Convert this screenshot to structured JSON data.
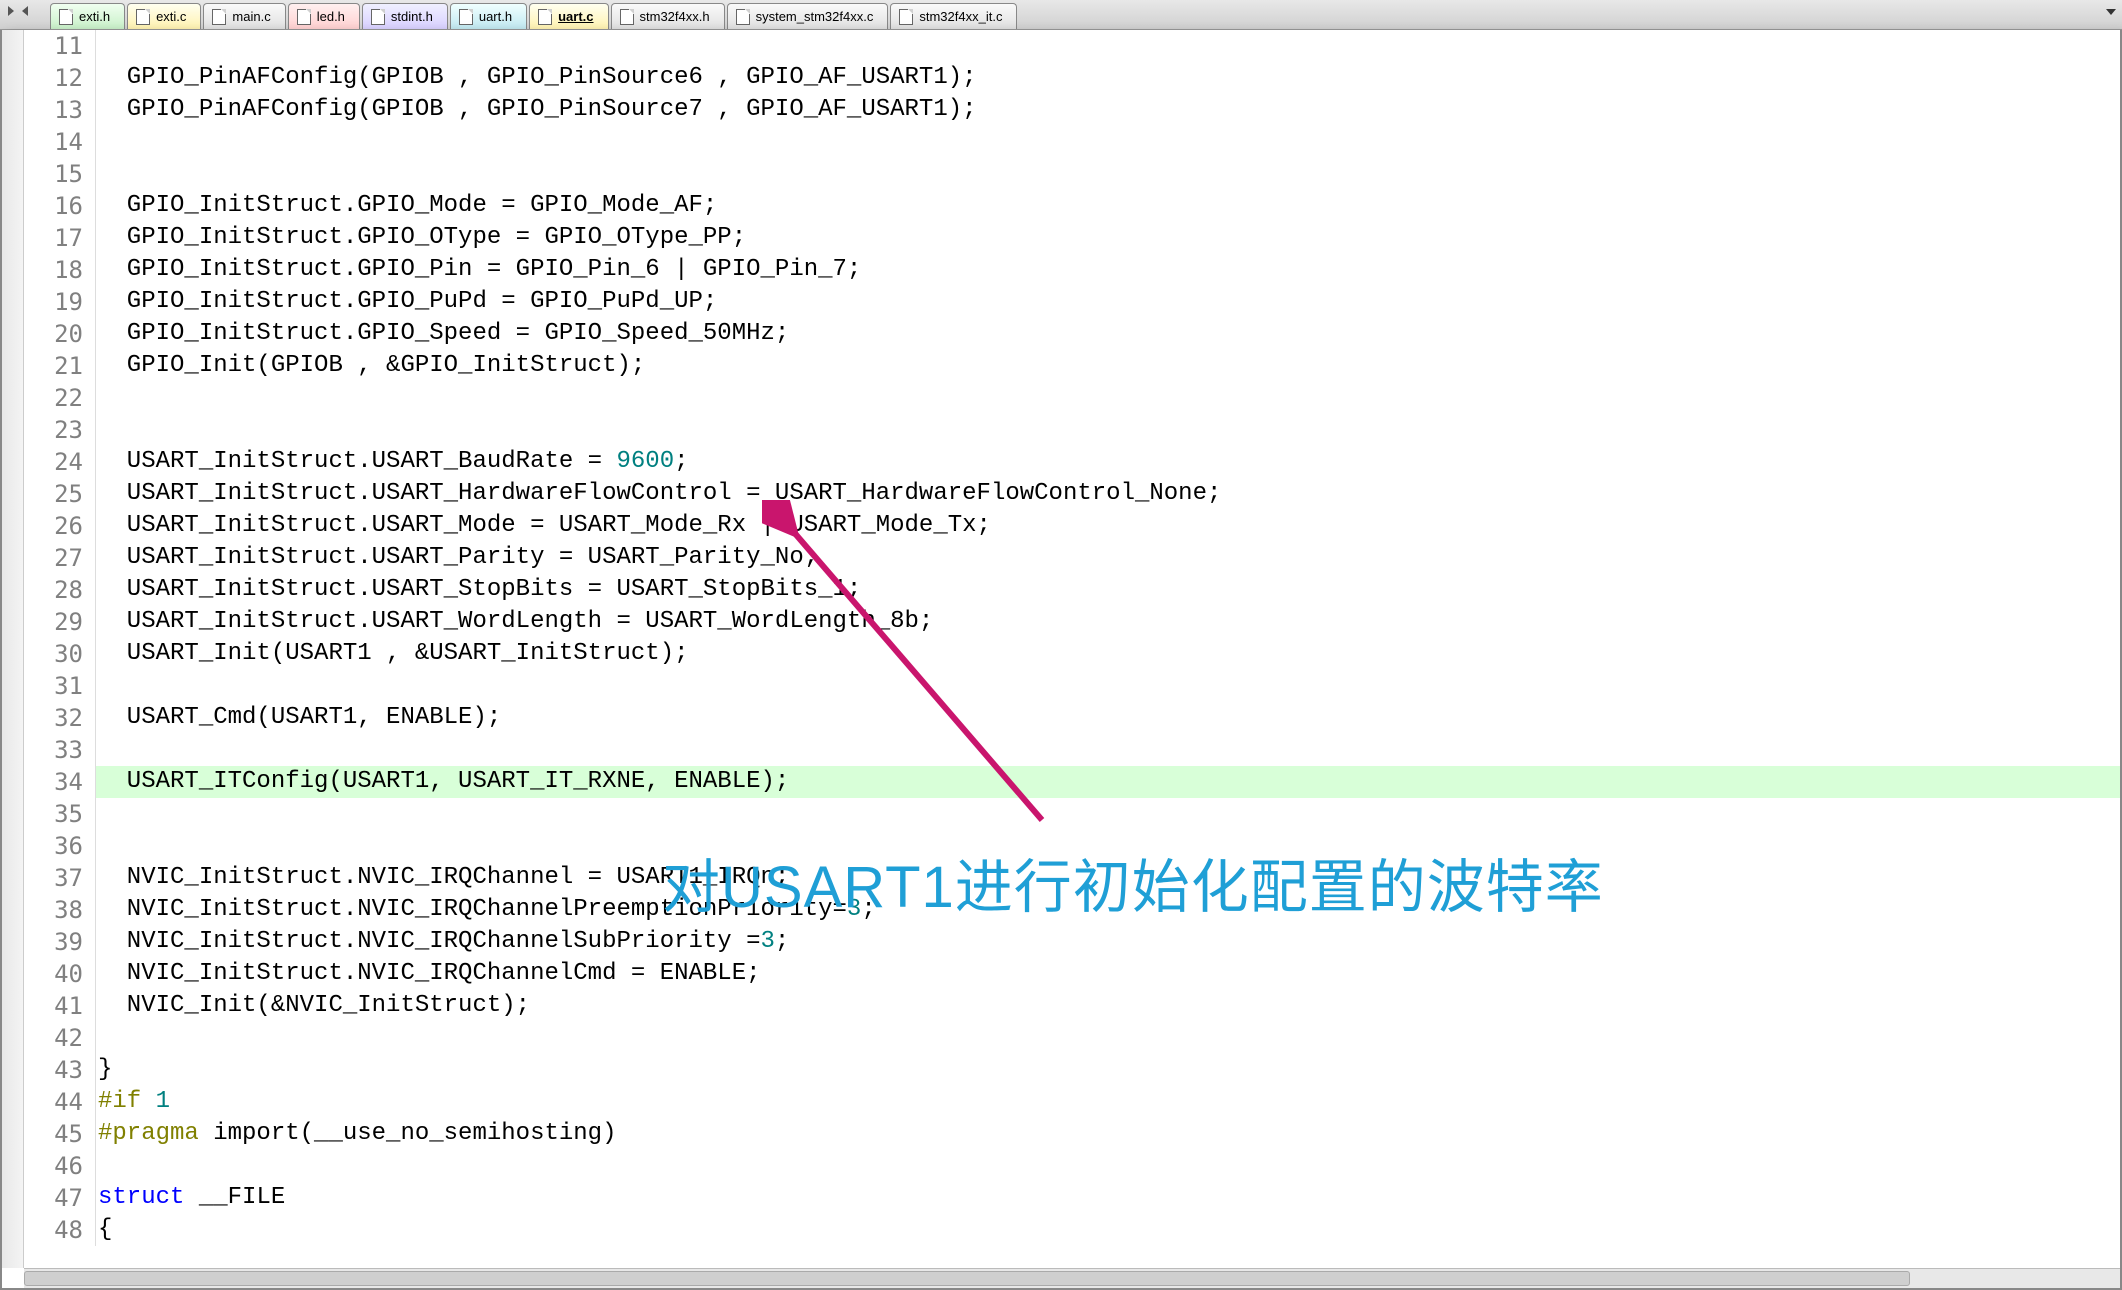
{
  "tabs": [
    {
      "label": "exti.h",
      "style": "green"
    },
    {
      "label": "exti.c",
      "style": "yellow"
    },
    {
      "label": "main.c",
      "style": "plain"
    },
    {
      "label": "led.h",
      "style": "pink"
    },
    {
      "label": "stdint.h",
      "style": "lav"
    },
    {
      "label": "uart.h",
      "style": "blue"
    },
    {
      "label": "uart.c",
      "style": "active",
      "active": true
    },
    {
      "label": "stm32f4xx.h",
      "style": "plain"
    },
    {
      "label": "system_stm32f4xx.c",
      "style": "plain"
    },
    {
      "label": "stm32f4xx_it.c",
      "style": "plain"
    }
  ],
  "annotation_text": "对USART1进行初始化配置的波特率",
  "code": [
    {
      "n": 11,
      "t": ""
    },
    {
      "n": 12,
      "t": "  GPIO_PinAFConfig(GPIOB , GPIO_PinSource6 , GPIO_AF_USART1);"
    },
    {
      "n": 13,
      "t": "  GPIO_PinAFConfig(GPIOB , GPIO_PinSource7 , GPIO_AF_USART1);"
    },
    {
      "n": 14,
      "t": ""
    },
    {
      "n": 15,
      "t": ""
    },
    {
      "n": 16,
      "t": "  GPIO_InitStruct.GPIO_Mode = GPIO_Mode_AF;"
    },
    {
      "n": 17,
      "t": "  GPIO_InitStruct.GPIO_OType = GPIO_OType_PP;"
    },
    {
      "n": 18,
      "t": "  GPIO_InitStruct.GPIO_Pin = GPIO_Pin_6 | GPIO_Pin_7;"
    },
    {
      "n": 19,
      "t": "  GPIO_InitStruct.GPIO_PuPd = GPIO_PuPd_UP;"
    },
    {
      "n": 20,
      "t": "  GPIO_InitStruct.GPIO_Speed = GPIO_Speed_50MHz;"
    },
    {
      "n": 21,
      "t": "  GPIO_Init(GPIOB , &GPIO_InitStruct);"
    },
    {
      "n": 22,
      "t": ""
    },
    {
      "n": 23,
      "t": ""
    },
    {
      "n": 24,
      "t": "  USART_InitStruct.USART_BaudRate = ",
      "num": "9600",
      "after": ";"
    },
    {
      "n": 25,
      "t": "  USART_InitStruct.USART_HardwareFlowControl = USART_HardwareFlowControl_None;"
    },
    {
      "n": 26,
      "t": "  USART_InitStruct.USART_Mode = USART_Mode_Rx | USART_Mode_Tx;"
    },
    {
      "n": 27,
      "t": "  USART_InitStruct.USART_Parity = USART_Parity_No;"
    },
    {
      "n": 28,
      "t": "  USART_InitStruct.USART_StopBits = USART_StopBits_1;"
    },
    {
      "n": 29,
      "t": "  USART_InitStruct.USART_WordLength = USART_WordLength_8b;"
    },
    {
      "n": 30,
      "t": "  USART_Init(USART1 , &USART_InitStruct);"
    },
    {
      "n": 31,
      "t": ""
    },
    {
      "n": 32,
      "t": "  USART_Cmd(USART1, ENABLE);"
    },
    {
      "n": 33,
      "t": ""
    },
    {
      "n": 34,
      "t": "  USART_ITConfig(USART1, USART_IT_RXNE, ENABLE);",
      "hl": true
    },
    {
      "n": 35,
      "t": ""
    },
    {
      "n": 36,
      "t": ""
    },
    {
      "n": 37,
      "t": "  NVIC_InitStruct.NVIC_IRQChannel = USART1_IRQn;"
    },
    {
      "n": 38,
      "t": "  NVIC_InitStruct.NVIC_IRQChannelPreemptionPriority=",
      "num": "3",
      "after": ";"
    },
    {
      "n": 39,
      "t": "  NVIC_InitStruct.NVIC_IRQChannelSubPriority =",
      "num": "3",
      "after": ";"
    },
    {
      "n": 40,
      "t": "  NVIC_InitStruct.NVIC_IRQChannelCmd = ENABLE;"
    },
    {
      "n": 41,
      "t": "  NVIC_Init(&NVIC_InitStruct);"
    },
    {
      "n": 42,
      "t": ""
    },
    {
      "n": 43,
      "t": "}"
    },
    {
      "n": 44,
      "pre": "#if ",
      "num": "1"
    },
    {
      "n": 45,
      "pre": "#pragma ",
      "t": "import(__use_no_semihosting)"
    },
    {
      "n": 46,
      "t": ""
    },
    {
      "n": 47,
      "kw": "struct ",
      "t": "__FILE"
    },
    {
      "n": 48,
      "t": "{"
    }
  ]
}
